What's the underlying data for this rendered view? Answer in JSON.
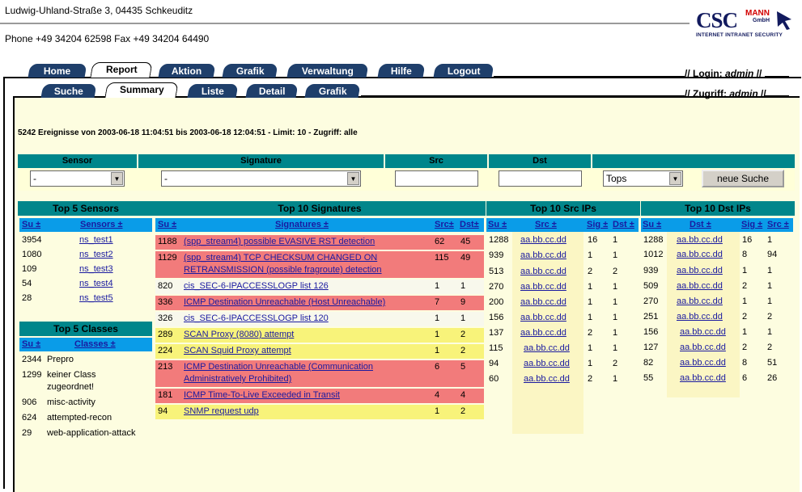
{
  "header": {
    "address": "Ludwig-Uhland-Straße 3, 04435 Schkeuditz",
    "phone": "Phone +49 34204 62598 Fax +49 34204 64490",
    "logo": {
      "csc": "CSC",
      "mann": "MANN",
      "gmbh": "GmbH",
      "tagline": "INTERNET INTRANET SECURITY"
    }
  },
  "nav": {
    "main_tabs": [
      "Home",
      "Report",
      "Aktion",
      "Grafik",
      "Verwaltung",
      "Hilfe",
      "Logout"
    ],
    "sub_tabs": [
      "Suche",
      "Summary",
      "Liste",
      "Detail",
      "Grafik"
    ],
    "login_label": "Login:",
    "login_user": "admin",
    "access_label": "Zugriff:",
    "access_user": "admin"
  },
  "summary_text": "5242 Ereignisse von 2003-06-18 11:04:51 bis 2003-06-18 12:04:51 - Limit: 10 - Zugriff: alle",
  "filter": {
    "headers": [
      "Sensor",
      "Signature",
      "Src",
      "Dst"
    ],
    "sensor_value": "-",
    "signature_value": "-",
    "tops_value": "Tops",
    "search_button": "neue Suche"
  },
  "sensors": {
    "title": "Top 5 Sensors",
    "col_su": "Su ±",
    "col_name": "Sensors ±",
    "rows": [
      {
        "su": "3954",
        "name": "ns_test1"
      },
      {
        "su": "1080",
        "name": "ns_test2"
      },
      {
        "su": "109",
        "name": "ns_test3"
      },
      {
        "su": "54",
        "name": "ns_test4"
      },
      {
        "su": "28",
        "name": "ns_test5"
      }
    ]
  },
  "classes": {
    "title": "Top 5 Classes",
    "col_su": "Su ±",
    "col_name": "Classes ±",
    "rows": [
      {
        "su": "2344",
        "name": "Prepro"
      },
      {
        "su": "1299",
        "name": "keiner Class",
        "name2": "zugeordnet!"
      },
      {
        "su": "906",
        "name": "misc-activity"
      },
      {
        "su": "624",
        "name": "attempted-recon"
      },
      {
        "su": "29",
        "name": "web-application-attack"
      }
    ]
  },
  "signatures": {
    "title": "Top 10 Signatures",
    "col_su": "Su ±",
    "col_name": "Signatures ±",
    "col_src": "Src±",
    "col_dst": "Dst±",
    "rows": [
      {
        "su": "1188",
        "l1": "(spp_stream4) possible EVASIVE RST detection",
        "l2": "",
        "src": "62",
        "dst": "45",
        "color": "pink"
      },
      {
        "su": "1129",
        "l1": "(spp_stream4) TCP CHECKSUM CHANGED ON",
        "l2": "RETRANSMISSION (possible fragroute) detection",
        "src": "115",
        "dst": "49",
        "color": "pink"
      },
      {
        "su": "820",
        "l1": "cis_SEC-6-IPACCESSLOGP list 126",
        "l2": "",
        "src": "1",
        "dst": "1",
        "color": "wht"
      },
      {
        "su": "336",
        "l1": "ICMP Destination Unreachable (Host Unreachable)",
        "l2": "",
        "src": "7",
        "dst": "9",
        "color": "pink"
      },
      {
        "su": "326",
        "l1": "cis_SEC-6-IPACCESSLOGP list 120",
        "l2": "",
        "src": "1",
        "dst": "1",
        "color": "wht"
      },
      {
        "su": "289",
        "l1": "SCAN Proxy (8080) attempt",
        "l2": "",
        "src": "1",
        "dst": "2",
        "color": "yel"
      },
      {
        "su": "224",
        "l1": "SCAN Squid Proxy attempt",
        "l2": "",
        "src": "1",
        "dst": "2",
        "color": "yel"
      },
      {
        "su": "213",
        "l1": "ICMP Destination Unreachable (Communication",
        "l2": "Administratively Prohibited)",
        "src": "6",
        "dst": "5",
        "color": "pink"
      },
      {
        "su": "181",
        "l1": "ICMP Time-To-Live Exceeded in Transit",
        "l2": "",
        "src": "4",
        "dst": "4",
        "color": "pink"
      },
      {
        "su": "94",
        "l1": "SNMP request udp",
        "l2": "",
        "src": "1",
        "dst": "2",
        "color": "yel"
      }
    ]
  },
  "src_ips": {
    "title": "Top 10 Src IPs",
    "col_su": "Su ±",
    "col_ip": "Src ±",
    "col_sig": "Sig ±",
    "col_other": "Dst ±",
    "rows": [
      {
        "su": "1288",
        "ip": "aa.bb.cc.dd",
        "sig": "16",
        "other": "1"
      },
      {
        "su": "939",
        "ip": "aa.bb.cc.dd",
        "sig": "1",
        "other": "1"
      },
      {
        "su": "513",
        "ip": "aa.bb.cc.dd",
        "sig": "2",
        "other": "2"
      },
      {
        "su": "270",
        "ip": "aa.bb.cc.dd",
        "sig": "1",
        "other": "1"
      },
      {
        "su": "200",
        "ip": "aa.bb.cc.dd",
        "sig": "1",
        "other": "1"
      },
      {
        "su": "156",
        "ip": "aa.bb.cc.dd",
        "sig": "1",
        "other": "1"
      },
      {
        "su": "137",
        "ip": "aa.bb.cc.dd",
        "sig": "2",
        "other": "1"
      },
      {
        "su": "115",
        "ip": "aa.bb.cc.dd",
        "sig": "1",
        "other": "1"
      },
      {
        "su": "94",
        "ip": "aa.bb.cc.dd",
        "sig": "1",
        "other": "2"
      },
      {
        "su": "60",
        "ip": "aa.bb.cc.dd",
        "sig": "2",
        "other": "1"
      }
    ]
  },
  "dst_ips": {
    "title": "Top 10 Dst IPs",
    "col_su": "Su ±",
    "col_ip": "Dst ±",
    "col_sig": "Sig ±",
    "col_other": "Src ±",
    "rows": [
      {
        "su": "1288",
        "ip": "aa.bb.cc.dd",
        "sig": "16",
        "other": "1"
      },
      {
        "su": "1012",
        "ip": "aa.bb.cc.dd",
        "sig": "8",
        "other": "94"
      },
      {
        "su": "939",
        "ip": "aa.bb.cc.dd",
        "sig": "1",
        "other": "1"
      },
      {
        "su": "509",
        "ip": "aa.bb.cc.dd",
        "sig": "2",
        "other": "1"
      },
      {
        "su": "270",
        "ip": "aa.bb.cc.dd",
        "sig": "1",
        "other": "1"
      },
      {
        "su": "251",
        "ip": "aa.bb.cc.dd",
        "sig": "2",
        "other": "2"
      },
      {
        "su": "156",
        "ip": "aa.bb.cc.dd",
        "sig": "1",
        "other": "1"
      },
      {
        "su": "127",
        "ip": "aa.bb.cc.dd",
        "sig": "2",
        "other": "2"
      },
      {
        "su": "82",
        "ip": "aa.bb.cc.dd",
        "sig": "8",
        "other": "51"
      },
      {
        "su": "55",
        "ip": "aa.bb.cc.dd",
        "sig": "6",
        "other": "26"
      }
    ]
  }
}
